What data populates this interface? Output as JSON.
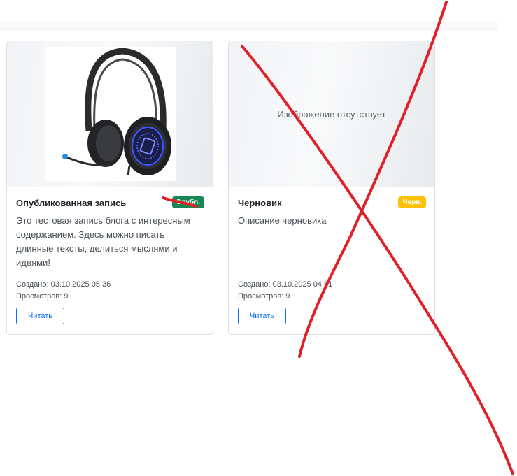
{
  "posts": [
    {
      "title": "Опубликованная запись",
      "status": "Опубл.",
      "status_color": "#198754",
      "excerpt": "Это тестовая запись блога с интересным содержанием. Здесь можно писать длинные тексты, делиться мыслями и идеями!",
      "created": "Создано: 03.10.2025 05:36",
      "views": "Просмотров: 9",
      "read_label": "Читать",
      "image": "headphones-image"
    },
    {
      "title": "Черновик",
      "status": "Черн.",
      "status_color": "#ffc107",
      "no_image_text": "Изображение отсутствует",
      "excerpt": "Описание черновика",
      "created": "Создано: 03.10.2025 04:51",
      "views": "Просмотров: 9",
      "read_label": "Читать"
    }
  ],
  "annotation": {
    "color": "#e0212a",
    "icon": "red-cross-annotation"
  }
}
